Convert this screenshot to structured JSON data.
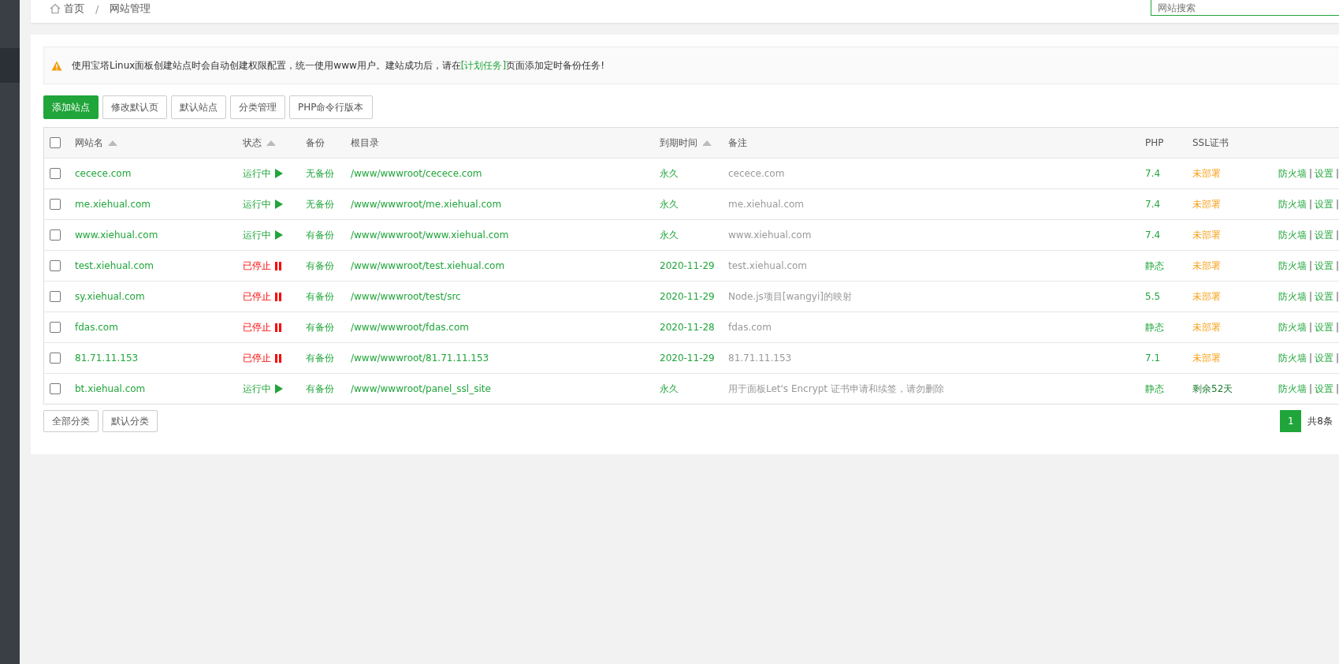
{
  "breadcrumb": {
    "home": "首页",
    "separator": "/",
    "current": "网站管理"
  },
  "search": {
    "placeholder": "网站搜索"
  },
  "notice": {
    "text_before": "使用宝塔Linux面板创建站点时会自动创建权限配置，统一使用www用户。建站成功后，请在",
    "link": "[计划任务]",
    "text_after": "页面添加定时备份任务!"
  },
  "toolbar": [
    {
      "label": "添加站点",
      "primary": true
    },
    {
      "label": "修改默认页",
      "primary": false
    },
    {
      "label": "默认站点",
      "primary": false
    },
    {
      "label": "分类管理",
      "primary": false
    },
    {
      "label": "PHP命令行版本",
      "primary": false
    }
  ],
  "table": {
    "select_all": false,
    "columns": [
      {
        "label": "网站名",
        "sortable": true
      },
      {
        "label": "状态",
        "sortable": true
      },
      {
        "label": "备份",
        "sortable": false
      },
      {
        "label": "根目录",
        "sortable": false
      },
      {
        "label": "到期时间",
        "sortable": true
      },
      {
        "label": "备注",
        "sortable": false
      },
      {
        "label": "PHP",
        "sortable": false
      },
      {
        "label": "SSL证书",
        "sortable": false
      }
    ],
    "action_separator": "|",
    "rows": [
      {
        "checked": false,
        "name": "cecece.com",
        "status": "运行中",
        "running": true,
        "backup": "无备份",
        "root": "/www/wwwroot/cecece.com",
        "expiry": "永久",
        "note": "cecece.com",
        "php": "7.4",
        "ssl": "未部署",
        "ssl_deployed": false,
        "actions": [
          "防火墙",
          "设置"
        ]
      },
      {
        "checked": false,
        "name": "me.xiehual.com",
        "status": "运行中",
        "running": true,
        "backup": "无备份",
        "root": "/www/wwwroot/me.xiehual.com",
        "expiry": "永久",
        "note": "me.xiehual.com",
        "php": "7.4",
        "ssl": "未部署",
        "ssl_deployed": false,
        "actions": [
          "防火墙",
          "设置"
        ]
      },
      {
        "checked": false,
        "name": "www.xiehual.com",
        "status": "运行中",
        "running": true,
        "backup": "有备份",
        "root": "/www/wwwroot/www.xiehual.com",
        "expiry": "永久",
        "note": "www.xiehual.com",
        "php": "7.4",
        "ssl": "未部署",
        "ssl_deployed": false,
        "actions": [
          "防火墙",
          "设置"
        ]
      },
      {
        "checked": false,
        "name": "test.xiehual.com",
        "status": "已停止",
        "running": false,
        "backup": "有备份",
        "root": "/www/wwwroot/test.xiehual.com",
        "expiry": "2020-11-29",
        "note": "test.xiehual.com",
        "php": "静态",
        "ssl": "未部署",
        "ssl_deployed": false,
        "actions": [
          "防火墙",
          "设置"
        ]
      },
      {
        "checked": false,
        "name": "sy.xiehual.com",
        "status": "已停止",
        "running": false,
        "backup": "有备份",
        "root": "/www/wwwroot/test/src",
        "expiry": "2020-11-29",
        "note": "Node.js项目[wangyi]的映射",
        "php": "5.5",
        "ssl": "未部署",
        "ssl_deployed": false,
        "actions": [
          "防火墙",
          "设置"
        ]
      },
      {
        "checked": false,
        "name": "fdas.com",
        "status": "已停止",
        "running": false,
        "backup": "有备份",
        "root": "/www/wwwroot/fdas.com",
        "expiry": "2020-11-28",
        "note": "fdas.com",
        "php": "静态",
        "ssl": "未部署",
        "ssl_deployed": false,
        "actions": [
          "防火墙",
          "设置"
        ]
      },
      {
        "checked": false,
        "name": "81.71.11.153",
        "status": "已停止",
        "running": false,
        "backup": "有备份",
        "root": "/www/wwwroot/81.71.11.153",
        "expiry": "2020-11-29",
        "note": "81.71.11.153",
        "php": "7.1",
        "ssl": "未部署",
        "ssl_deployed": false,
        "actions": [
          "防火墙",
          "设置"
        ]
      },
      {
        "checked": false,
        "name": "bt.xiehual.com",
        "status": "运行中",
        "running": true,
        "backup": "有备份",
        "root": "/www/wwwroot/panel_ssl_site",
        "expiry": "永久",
        "note": "用于面板Let's Encrypt 证书申请和续签，请勿删除",
        "php": "静态",
        "ssl": "剩余52天",
        "ssl_deployed": true,
        "actions": [
          "防火墙",
          "设置"
        ]
      }
    ]
  },
  "category_buttons": [
    "全部分类",
    "默认分类"
  ],
  "pagination": {
    "pages": [
      {
        "label": "1",
        "selected": true
      }
    ],
    "total": "共8条"
  }
}
